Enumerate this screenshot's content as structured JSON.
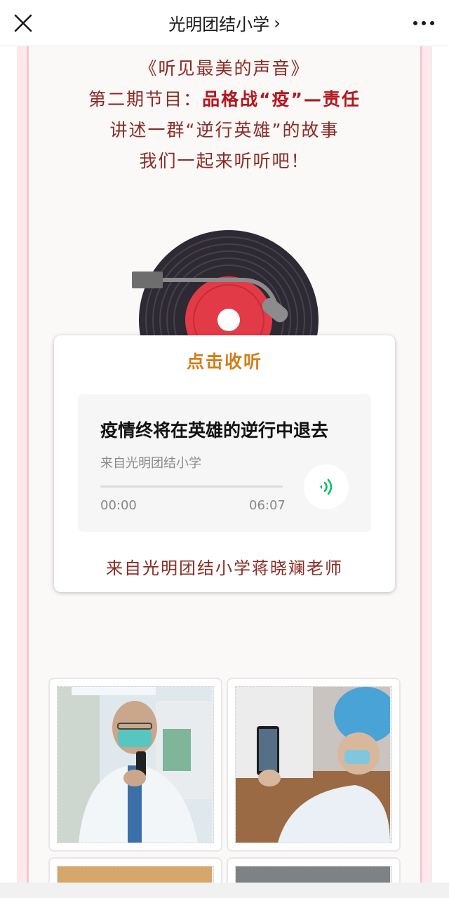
{
  "nav": {
    "title": "光明团结小学",
    "chevron": "›",
    "close_icon": "close-icon",
    "more_icon": "more-dots-icon"
  },
  "intro": {
    "line1": "《听见最美的声音》",
    "line2_prefix": "第二期节目：",
    "line2_highlight": "品格战“疫”—责任",
    "line3": "讲述一群“逆行英雄”的故事",
    "line4": "我们一起来听听吧！"
  },
  "audio_card": {
    "title": "点击收听",
    "track_title": "疫情终将在英雄的逆行中退去",
    "track_source": "来自光明团结小学",
    "time_current": "00:00",
    "time_total": "06:07",
    "progress": 0,
    "footer": "来自光明团结小学蒋晓斓老师"
  },
  "colors": {
    "accent_green": "#07c160",
    "title_red": "#b3161d",
    "text_brown": "#8a2b23",
    "card_orange": "#d37d1a"
  }
}
